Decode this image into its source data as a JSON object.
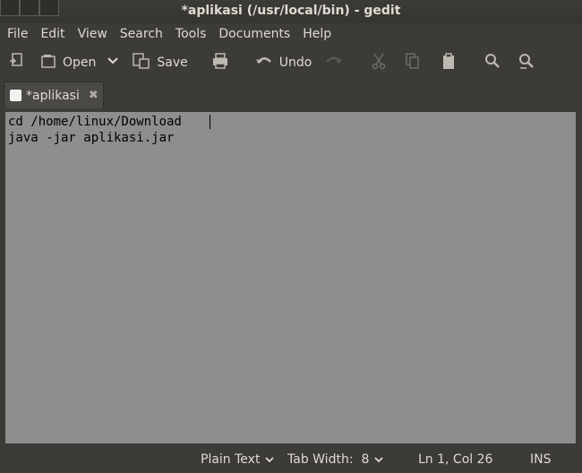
{
  "window": {
    "title": "*aplikasi (/usr/local/bin) - gedit"
  },
  "menubar": {
    "items": [
      "File",
      "Edit",
      "View",
      "Search",
      "Tools",
      "Documents",
      "Help"
    ]
  },
  "toolbar": {
    "new_icon": "new-document-icon",
    "open_label": "Open",
    "save_label": "Save",
    "print_icon": "print-icon",
    "undo_label": "Undo",
    "redo_icon": "redo-icon",
    "cut_icon": "cut-icon",
    "copy_icon": "copy-icon",
    "paste_icon": "paste-icon",
    "find_icon": "find-icon",
    "replace_icon": "find-replace-icon"
  },
  "tabs": [
    {
      "label": "*aplikasi"
    }
  ],
  "editor": {
    "lines": [
      "cd /home/linux/Download",
      "java -jar aplikasi.jar"
    ]
  },
  "statusbar": {
    "language": "Plain Text",
    "tab_width": "Tab Width:  8",
    "position": "Ln 1, Col 26",
    "mode": "INS"
  }
}
